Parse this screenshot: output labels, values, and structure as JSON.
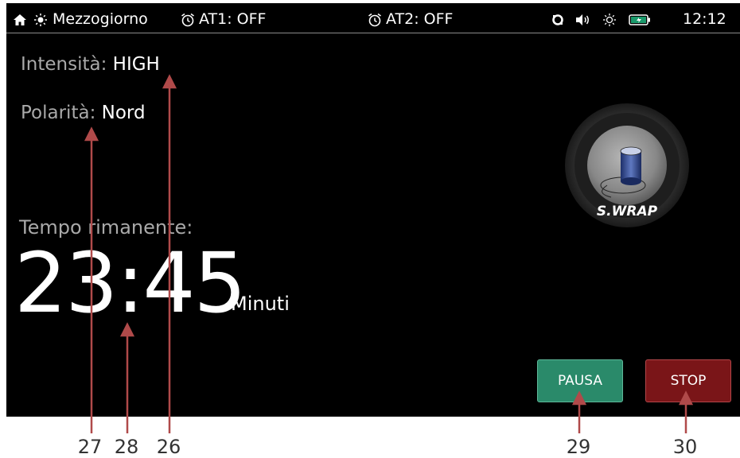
{
  "status_bar": {
    "mode": "Mezzogiorno",
    "alarm1": "AT1: OFF",
    "alarm2": "AT2: OFF",
    "clock": "12:12"
  },
  "session": {
    "intensity_label": "Intensità:",
    "intensity_value": "HIGH",
    "polarity_label": "Polarità:",
    "polarity_value": "Nord",
    "remaining_label": "Tempo rimanente:",
    "remaining_time": "23:45",
    "remaining_unit": "Minuti"
  },
  "device": {
    "name": "S.WRAP",
    "icon": "device-coil-icon"
  },
  "buttons": {
    "pause": "PAUSA",
    "stop": "STOP"
  },
  "callouts": {
    "c27": "27",
    "c28": "28",
    "c26": "26",
    "c29": "29",
    "c30": "30"
  },
  "colors": {
    "background": "#000000",
    "pause_button": "#2a8a6a",
    "stop_button": "#7a1518",
    "callout_line": "#b04a4a"
  }
}
